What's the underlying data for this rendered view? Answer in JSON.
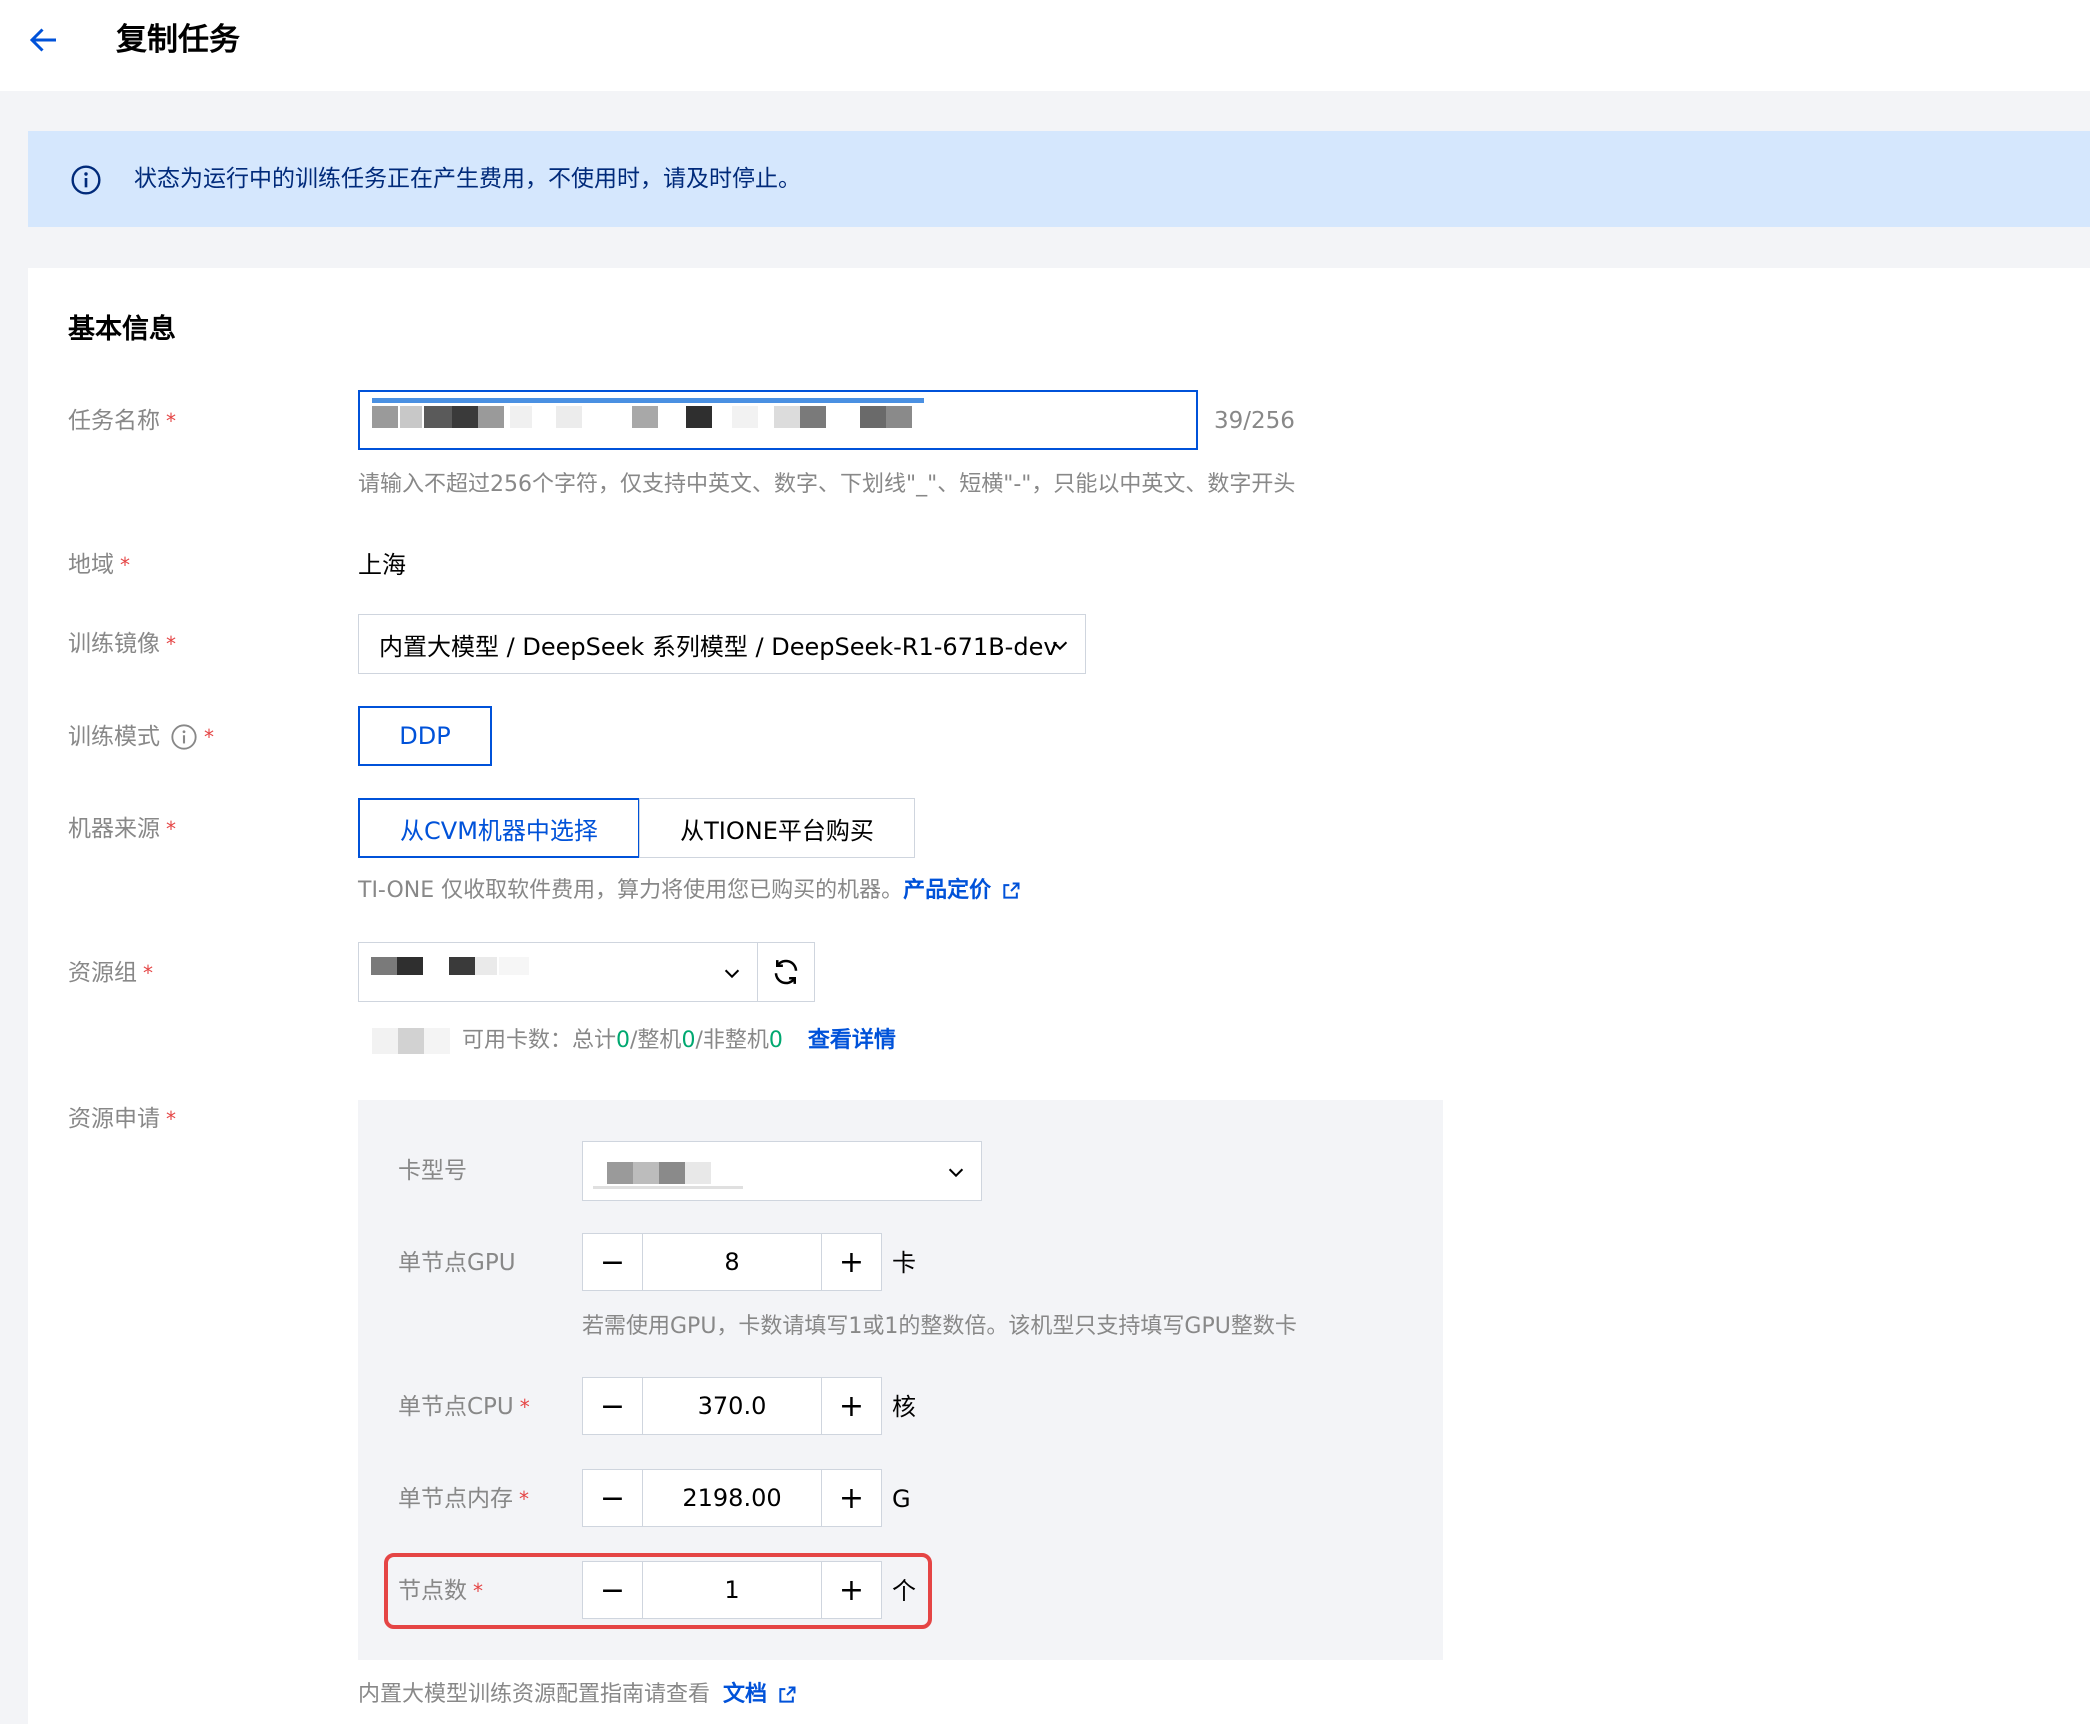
{
  "header": {
    "title": "复制任务"
  },
  "banner": {
    "text": "状态为运行中的训练任务正在产生费用，不使用时，请及时停止。"
  },
  "section": {
    "title": "基本信息"
  },
  "task_name": {
    "label": "任务名称",
    "counter": "39/256",
    "help": "请输入不超过256个字符，仅支持中英文、数字、下划线\"_\"、短横\"-\"，只能以中英文、数字开头"
  },
  "region": {
    "label": "地域",
    "value": "上海"
  },
  "image": {
    "label": "训练镜像",
    "value": "内置大模型 / DeepSeek 系列模型 / DeepSeek-R1-671B-dev"
  },
  "mode": {
    "label": "训练模式",
    "option": "DDP"
  },
  "machine_source": {
    "label": "机器来源",
    "options": [
      "从CVM机器中选择",
      "从TIONE平台购买"
    ],
    "help": "TI-ONE 仅收取软件费用，算力将使用您已购买的机器。",
    "link": "产品定价"
  },
  "resource_group": {
    "label": "资源组",
    "usage_prefix": "可用卡数：总计",
    "total": "0",
    "sep1": "/整机",
    "whole": "0",
    "sep2": "/非整机",
    "partial": "0",
    "details_link": "查看详情"
  },
  "resource_request": {
    "label": "资源申请",
    "card_type_label": "卡型号",
    "gpu": {
      "label": "单节点GPU",
      "value": "8",
      "unit": "卡",
      "help": "若需使用GPU，卡数请填写1或1的整数倍。该机型只支持填写GPU整数卡"
    },
    "cpu": {
      "label": "单节点CPU",
      "value": "370.0",
      "unit": "核"
    },
    "memory": {
      "label": "单节点内存",
      "value": "2198.00",
      "unit": "G"
    },
    "nodes": {
      "label": "节点数",
      "value": "1",
      "unit": "个"
    },
    "minus": "−",
    "plus": "+"
  },
  "footer": {
    "text": "内置大模型训练资源配置指南请查看",
    "link": "文档"
  },
  "colors": {
    "primary": "#0052d9",
    "required": "#e54545",
    "success": "#00a870",
    "banner_bg": "#d5e7fd"
  },
  "icons": [
    "back-arrow-icon",
    "info-icon",
    "chevron-down-icon",
    "refresh-icon",
    "external-link-icon"
  ]
}
